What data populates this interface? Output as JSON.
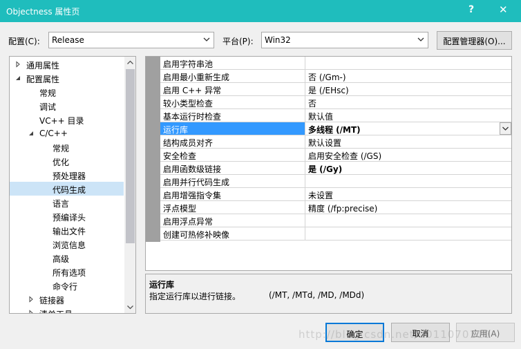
{
  "window": {
    "title": "Objectness 属性页",
    "help_glyph": "?",
    "close_glyph": "✕"
  },
  "toolbar": {
    "config_label": "配置(C):",
    "config_value": "Release",
    "platform_label": "平台(P):",
    "platform_value": "Win32",
    "config_manager_label": "配置管理器(O)..."
  },
  "tree": {
    "items": [
      {
        "label": "通用属性",
        "expander": "collapsed"
      },
      {
        "label": "配置属性",
        "expander": "expanded"
      },
      {
        "label": "常规",
        "expander": ""
      },
      {
        "label": "调试",
        "expander": ""
      },
      {
        "label": "VC++ 目录",
        "expander": ""
      },
      {
        "label": "C/C++",
        "expander": "expanded"
      },
      {
        "label": "常规",
        "expander": ""
      },
      {
        "label": "优化",
        "expander": ""
      },
      {
        "label": "预处理器",
        "expander": ""
      },
      {
        "label": "代码生成",
        "expander": "",
        "selected": true
      },
      {
        "label": "语言",
        "expander": ""
      },
      {
        "label": "预编译头",
        "expander": ""
      },
      {
        "label": "输出文件",
        "expander": ""
      },
      {
        "label": "浏览信息",
        "expander": ""
      },
      {
        "label": "高级",
        "expander": ""
      },
      {
        "label": "所有选项",
        "expander": ""
      },
      {
        "label": "命令行",
        "expander": ""
      },
      {
        "label": "链接器",
        "expander": "collapsed"
      },
      {
        "label": "清单工具",
        "expander": "collapsed"
      }
    ]
  },
  "grid": {
    "rows": [
      {
        "name": "启用字符串池",
        "value": ""
      },
      {
        "name": "启用最小重新生成",
        "value": "否 (/Gm-)"
      },
      {
        "name": "启用 C++ 异常",
        "value": "是 (/EHsc)"
      },
      {
        "name": "较小类型检查",
        "value": "否"
      },
      {
        "name": "基本运行时检查",
        "value": "默认值"
      },
      {
        "name": "运行库",
        "value": "多线程 (/MT)",
        "bold": true,
        "selected": true
      },
      {
        "name": "结构成员对齐",
        "value": "默认设置"
      },
      {
        "name": "安全检查",
        "value": "启用安全检查 (/GS)"
      },
      {
        "name": "启用函数级链接",
        "value": "是 (/Gy)",
        "bold": true
      },
      {
        "name": "启用并行代码生成",
        "value": ""
      },
      {
        "name": "启用增强指令集",
        "value": "未设置"
      },
      {
        "name": "浮点模型",
        "value": "精度 (/fp:precise)"
      },
      {
        "name": "启用浮点异常",
        "value": ""
      },
      {
        "name": "创建可热修补映像",
        "value": ""
      }
    ]
  },
  "description": {
    "title": "运行库",
    "body": "指定运行库以进行链接。",
    "options": "(/MT, /MTd, /MD, /MDd)"
  },
  "buttons": {
    "ok": "确定",
    "cancel": "取消",
    "apply": "应用(A)"
  },
  "watermark": "http://blog.csdn.net/u011070110"
}
